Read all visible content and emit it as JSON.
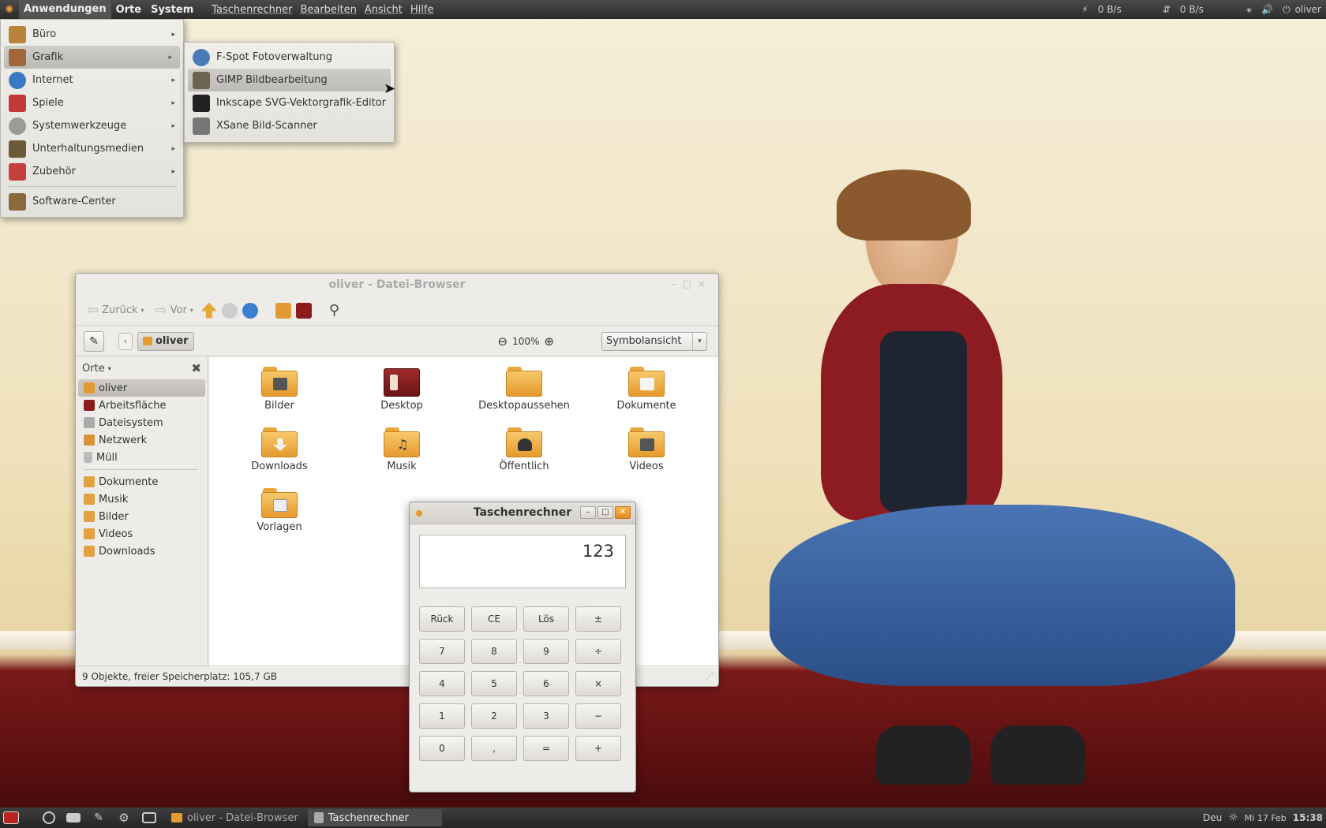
{
  "top_panel": {
    "menus": [
      "Anwendungen",
      "Orte",
      "System"
    ],
    "app_menus": [
      "Taschenrechner",
      "Bearbeiten",
      "Ansicht",
      "Hilfe"
    ],
    "net_up": "0 B/s",
    "net_down": "0 B/s",
    "user": "oliver"
  },
  "apps_menu": {
    "items": [
      {
        "label": "Büro",
        "icon": "office-icon",
        "color": "#b8843c"
      },
      {
        "label": "Grafik",
        "icon": "graphics-icon",
        "color": "#a0683a"
      },
      {
        "label": "Internet",
        "icon": "internet-icon",
        "color": "#3b78c3"
      },
      {
        "label": "Spiele",
        "icon": "games-icon",
        "color": "#c23a3a"
      },
      {
        "label": "Systemwerkzeuge",
        "icon": "system-tools-icon",
        "color": "#9a9a96"
      },
      {
        "label": "Unterhaltungsmedien",
        "icon": "multimedia-icon",
        "color": "#6b5a3a"
      },
      {
        "label": "Zubehör",
        "icon": "accessories-icon",
        "color": "#c44040"
      }
    ],
    "software_center": "Software-Center"
  },
  "graphics_menu": {
    "items": [
      {
        "label": "F-Spot Fotoverwaltung",
        "icon": "fspot-icon",
        "color": "#4a7ab8"
      },
      {
        "label": "GIMP Bildbearbeitung",
        "icon": "gimp-icon",
        "color": "#6b6450"
      },
      {
        "label": "Inkscape SVG-Vektorgrafik-Editor",
        "icon": "inkscape-icon",
        "color": "#222222"
      },
      {
        "label": "XSane Bild-Scanner",
        "icon": "scanner-icon",
        "color": "#777777"
      }
    ]
  },
  "file_browser": {
    "title": "oliver - Datei-Browser",
    "toolbar": {
      "back": "Zurück",
      "forward": "Vor"
    },
    "location": "oliver",
    "zoom": "100%",
    "view": "Symbolansicht",
    "sidebar": {
      "header": "Orte",
      "places": [
        "oliver",
        "Arbeitsfläche",
        "Dateisystem",
        "Netzwerk",
        "Müll"
      ],
      "bookmarks": [
        "Dokumente",
        "Musik",
        "Bilder",
        "Videos",
        "Downloads"
      ]
    },
    "files": [
      "Bilder",
      "Desktop",
      "Desktopaussehen",
      "Dokumente",
      "Downloads",
      "Musik",
      "Öffentlich",
      "Videos",
      "Vorlagen"
    ],
    "status": "9 Objekte, freier Speicherplatz: 105,7 GB"
  },
  "calculator": {
    "title": "Taschenrechner",
    "display": "123",
    "buttons": [
      "Rück",
      "CE",
      "Lös",
      "±",
      "7",
      "8",
      "9",
      "÷",
      "4",
      "5",
      "6",
      "×",
      "1",
      "2",
      "3",
      "−",
      "0",
      ",",
      "=",
      "+"
    ]
  },
  "bottom_panel": {
    "tasks": [
      "oliver - Datei-Browser",
      "Taschenrechner"
    ],
    "keyboard": "Deu",
    "date": "Mi 17 Feb",
    "time": "15:38"
  }
}
